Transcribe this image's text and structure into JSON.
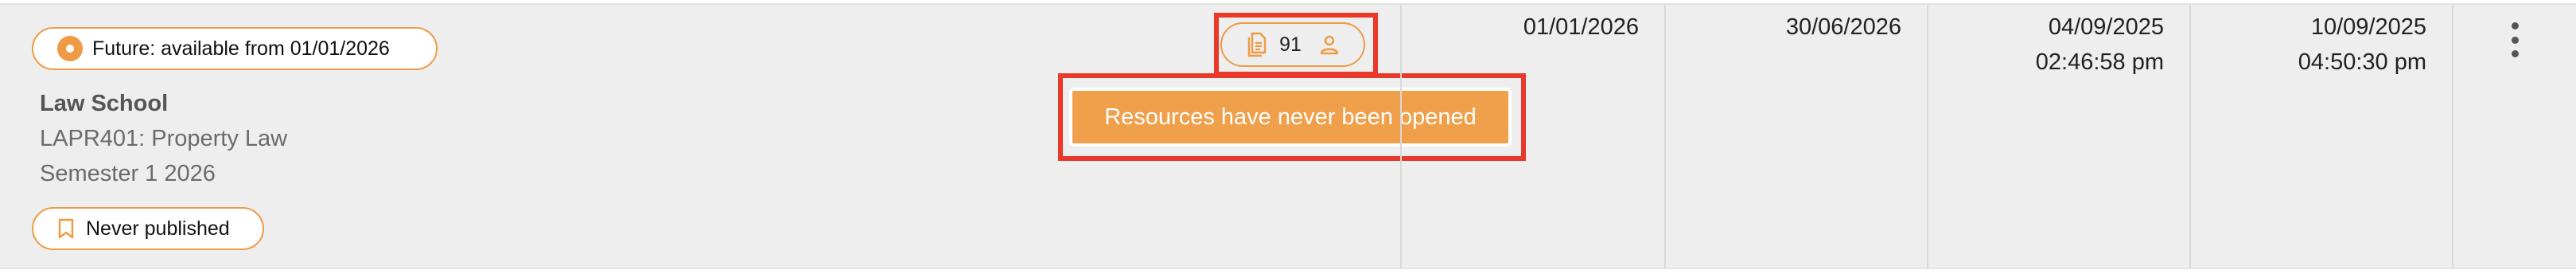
{
  "status_badge": {
    "label": "Future: available from 01/01/2026",
    "icon": "radio-dot-icon"
  },
  "course": {
    "school": "Law School",
    "name": "LAPR401: Property Law",
    "semester": "Semester 1 2026"
  },
  "publish_badge": {
    "label": "Never published",
    "icon": "bookmark-icon"
  },
  "resource_stats": {
    "count": "91",
    "doc_icon": "document-icon",
    "person_icon": "person-icon"
  },
  "tooltip": {
    "text": "Resources have never been opened"
  },
  "columns": {
    "start_date": "01/01/2026",
    "end_date": "30/06/2026",
    "created_date": "04/09/2025",
    "created_time": "02:46:58 pm",
    "modified_date": "10/09/2025",
    "modified_time": "04:50:30 pm"
  },
  "actions": {
    "icon": "more-vertical-icon"
  },
  "colors": {
    "accent": "#ef9b45",
    "tooltip_bg": "#f0a04b",
    "highlight": "#e8392b",
    "row_bg": "#eeeeee"
  }
}
